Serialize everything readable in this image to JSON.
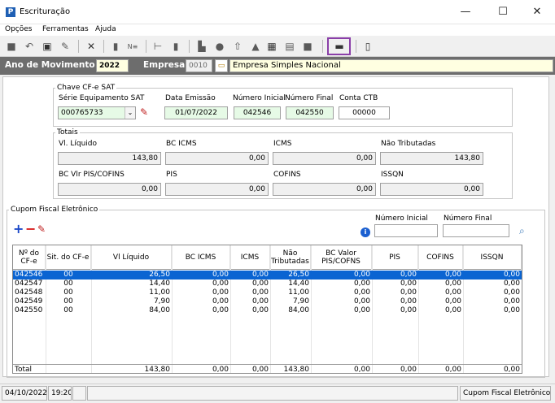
{
  "window": {
    "title": "Escrituração",
    "minimize": "—",
    "maximize": "☐",
    "close": "✕"
  },
  "menu": [
    "Opções",
    "Ferramentas",
    "Ajuda"
  ],
  "header": {
    "ano_label": "Ano de Movimento",
    "ano_value": "2022",
    "empresa_label": "Empresa",
    "empresa_code": "0010",
    "empresa_name": "Empresa Simples Nacional"
  },
  "chave": {
    "legend": "Chave CF-e SAT",
    "serie_label": "Série Equipamento SAT",
    "serie_value": "000765733",
    "data_label": "Data Emissão",
    "data_value": "01/07/2022",
    "num_ini_label": "Número Inicial",
    "num_ini_value": "042546",
    "num_fim_label": "Número Final",
    "num_fim_value": "042550",
    "conta_label": "Conta CTB",
    "conta_value": "00000"
  },
  "totais": {
    "legend": "Totais",
    "vl_liquido_label": "Vl. Líquido",
    "vl_liquido": "143,80",
    "bc_icms_label": "BC ICMS",
    "bc_icms": "0,00",
    "icms_label": "ICMS",
    "icms": "0,00",
    "nao_trib_label": "Não Tributadas",
    "nao_trib": "143,80",
    "bc_pis_label": "BC Vlr PIS/COFINS",
    "bc_pis": "0,00",
    "pis_label": "PIS",
    "pis": "0,00",
    "cofins_label": "COFINS",
    "cofins": "0,00",
    "issqn_label": "ISSQN",
    "issqn": "0,00"
  },
  "cupom": {
    "legend": "Cupom Fiscal Eletrônico",
    "num_ini_label": "Número Inicial",
    "num_ini_value": "",
    "num_fim_label": "Número Final",
    "num_fim_value": "",
    "columns": [
      "Nº do CF-e",
      "Sit. do CF-e",
      "Vl Líquido",
      "BC ICMS",
      "ICMS",
      "Não Tributadas",
      "BC Valor PIS/COFNS",
      "PIS",
      "COFINS",
      "ISSQN"
    ],
    "rows": [
      [
        "042546",
        "00",
        "26,50",
        "0,00",
        "0,00",
        "26,50",
        "0,00",
        "0,00",
        "0,00",
        "0,00"
      ],
      [
        "042547",
        "00",
        "14,40",
        "0,00",
        "0,00",
        "14,40",
        "0,00",
        "0,00",
        "0,00",
        "0,00"
      ],
      [
        "042548",
        "00",
        "11,00",
        "0,00",
        "0,00",
        "11,00",
        "0,00",
        "0,00",
        "0,00",
        "0,00"
      ],
      [
        "042549",
        "00",
        "7,90",
        "0,00",
        "0,00",
        "7,90",
        "0,00",
        "0,00",
        "0,00",
        "0,00"
      ],
      [
        "042550",
        "00",
        "84,00",
        "0,00",
        "0,00",
        "84,00",
        "0,00",
        "0,00",
        "0,00",
        "0,00"
      ]
    ],
    "total": [
      "Total",
      "",
      "143,80",
      "0,00",
      "0,00",
      "143,80",
      "0,00",
      "0,00",
      "0,00",
      "0,00"
    ]
  },
  "status": {
    "date": "04/10/2022",
    "time": "19:20",
    "module": "Cupom Fiscal Eletrônico"
  },
  "colors": {
    "selection": "#0a64d2",
    "header_band": "#6d6d6d",
    "highlight": "#8a3fa8"
  }
}
